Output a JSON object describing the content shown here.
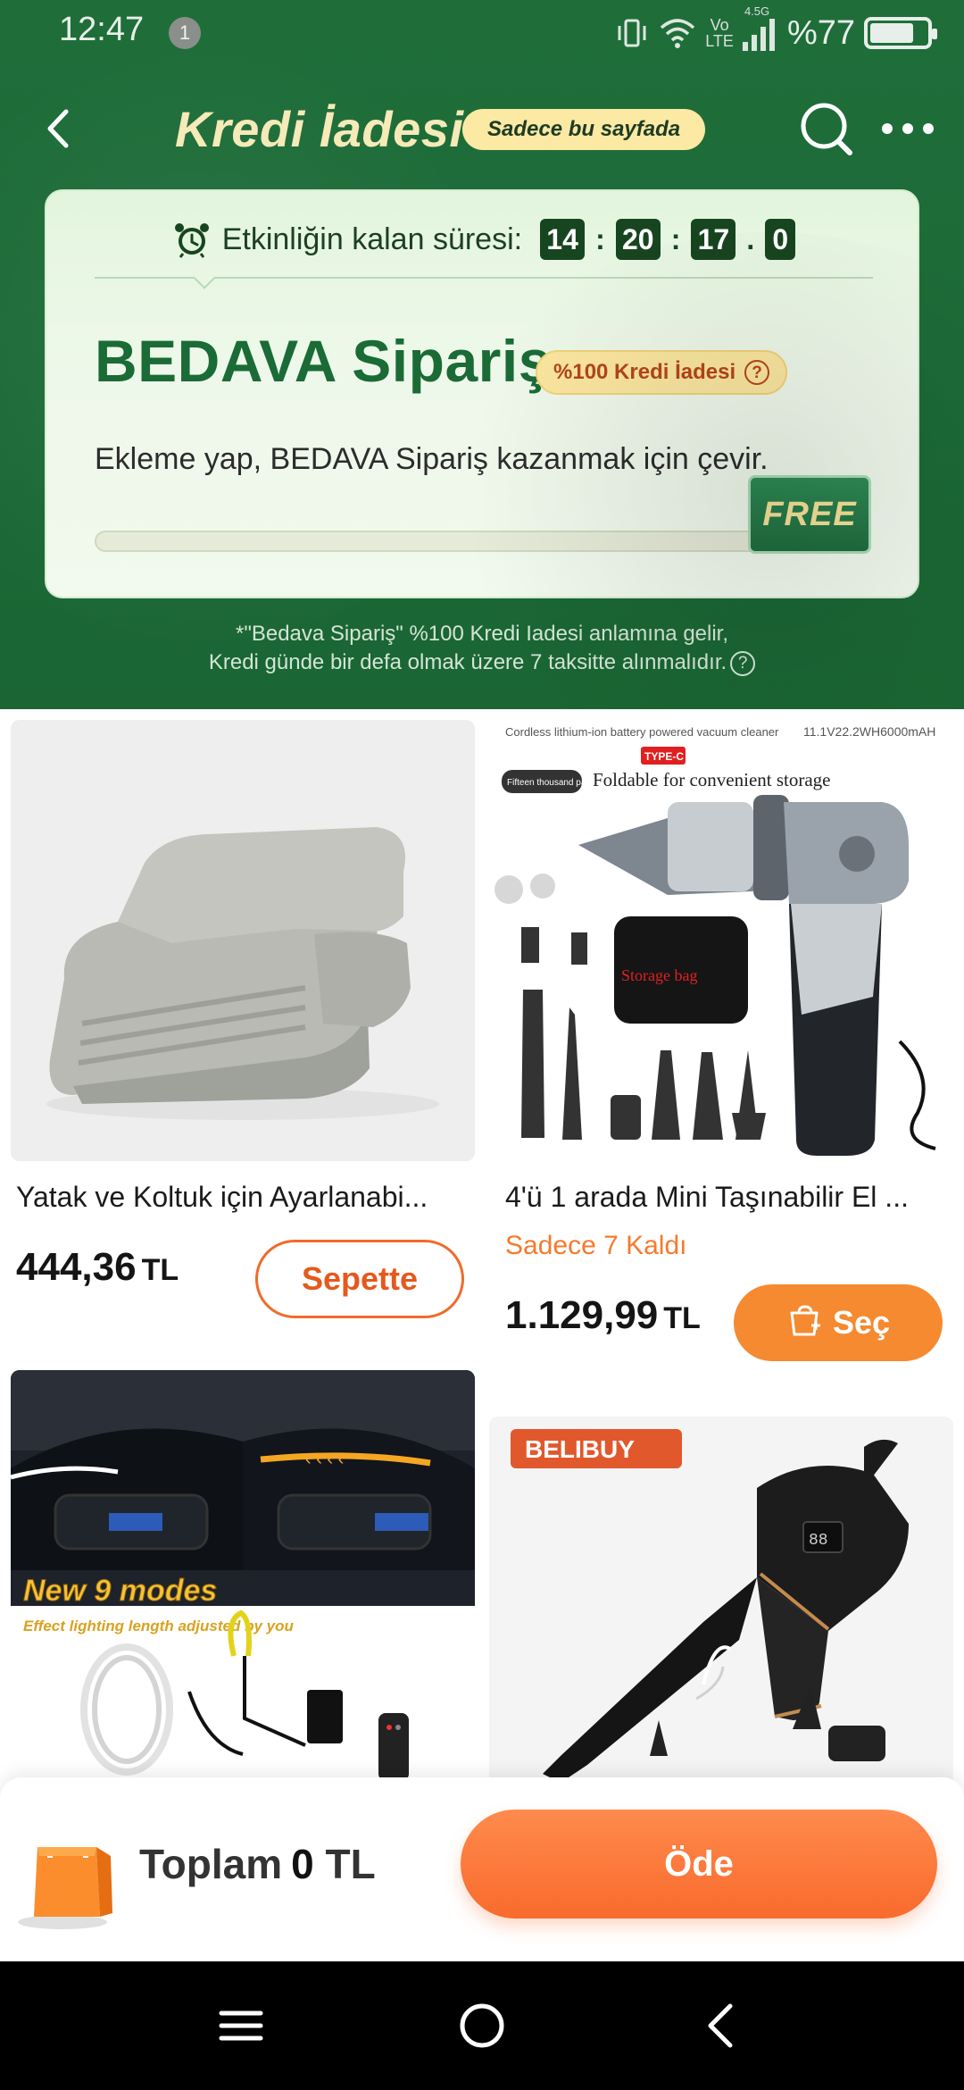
{
  "status_bar": {
    "time": "12:47",
    "notification_count": "1",
    "network_top": "Vo",
    "network_bottom": "LTE",
    "network_gen": "4.5G",
    "battery": "%77",
    "battery_level": 0.77
  },
  "header": {
    "title": "Kredi İadesi",
    "only_this_page": "Sadece bu sayfada"
  },
  "promo": {
    "timer_label": "Etkinliğin kalan süresi:",
    "timer": {
      "h": "14",
      "m": "20",
      "s": "17",
      "ms": "0"
    },
    "headline": "BEDAVA Sipariş",
    "credit_badge": "%100 Kredi İadesi",
    "help_glyph": "?",
    "description": "Ekleme yap, BEDAVA Sipariş kazanmak için çevir.",
    "progress": 0,
    "free_button": "FREE"
  },
  "footnote": {
    "line1": "*\"Bedava Sipariş\" %100 Kredi Iadesi anlamına gelir,",
    "line2": "Kredi günde bir defa olmak üzere 7 taksitte alınmalıdır."
  },
  "products": [
    {
      "name": "Yatak ve Koltuk için Ayarlanabi...",
      "price": "444,36",
      "currency": "TL",
      "button": "Sepette"
    },
    {
      "name": "4'ü 1 arada Mini Taşınabilir El ...",
      "stock_note": "Sadece 7 Kaldı",
      "price": "1.129,99",
      "currency": "TL",
      "button": "Seç",
      "image_texts": {
        "top_left": "Cordless lithium-ion battery powered vacuum cleaner",
        "top_right": "11.1V22.2WH6000mAH",
        "type_c": "TYPE-C",
        "pascals": "Fifteen thousand pascals",
        "foldable": "Foldable for convenient storage",
        "storage_bag": "Storage bag"
      }
    },
    {
      "image_texts": {
        "modes": "New 9 modes",
        "sub": "Effect lighting length adjusted by you"
      }
    },
    {
      "image_texts": {
        "brand": "BELIBUY"
      }
    }
  ],
  "paybar": {
    "total_label": "Toplam",
    "total_value": "0",
    "total_currency": "TL",
    "pay_button": "Öde"
  },
  "colors": {
    "header_green": "#1f6e3a",
    "accent_orange": "#f58a30",
    "title_cream": "#f6eab8"
  }
}
